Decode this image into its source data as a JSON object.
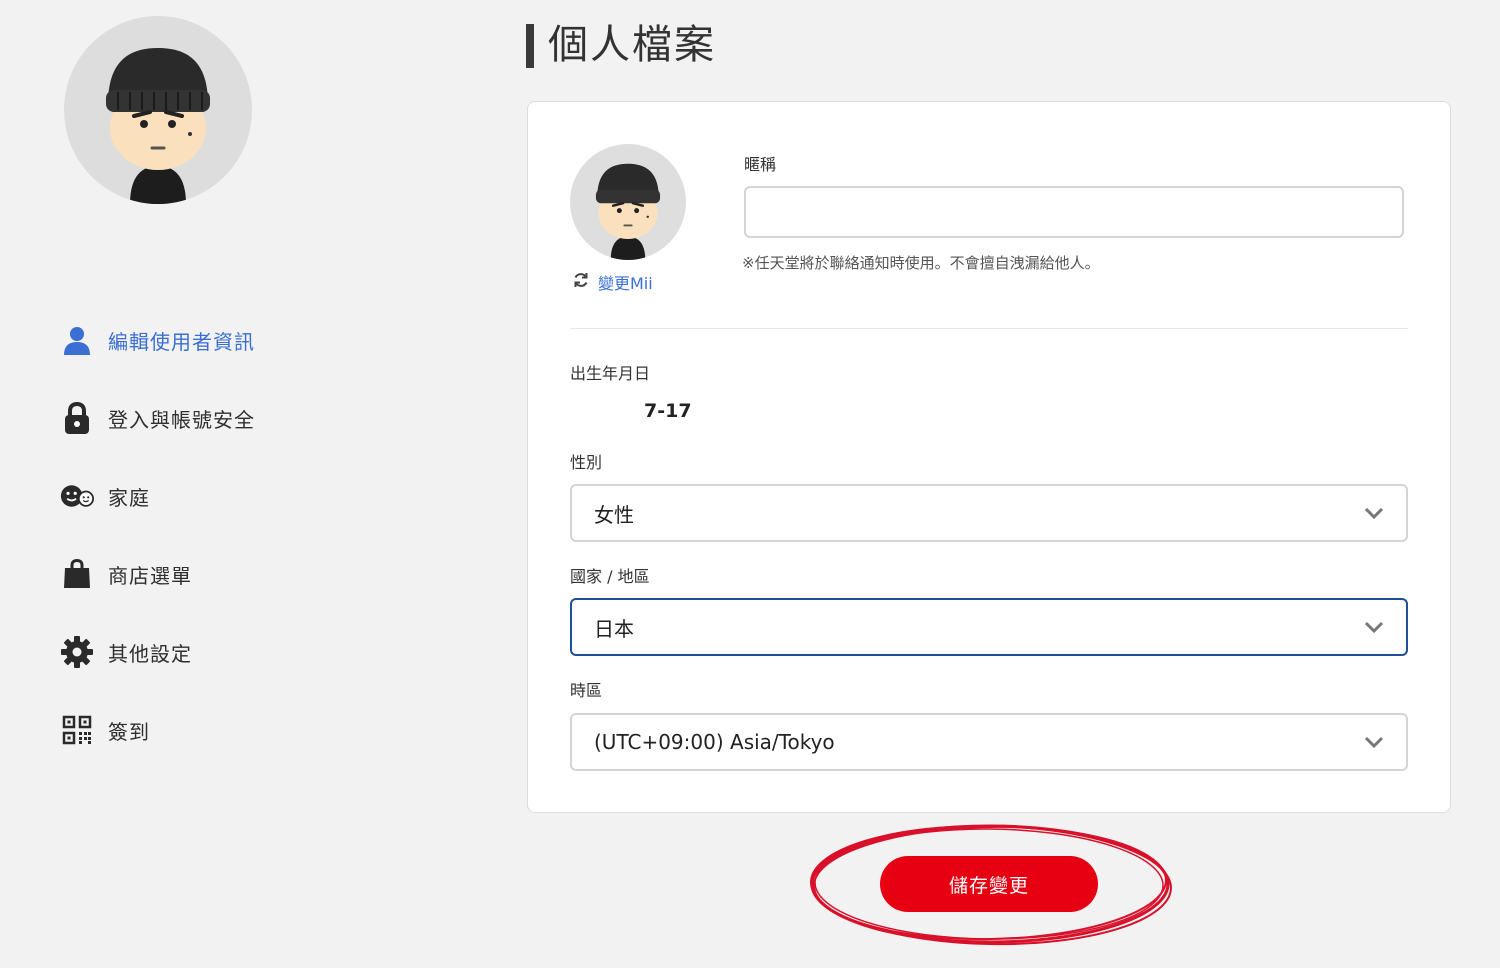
{
  "page": {
    "title": "個人檔案"
  },
  "sidebar": {
    "items": [
      {
        "label": "編輯使用者資訊",
        "icon": "user-icon",
        "active": true
      },
      {
        "label": "登入與帳號安全",
        "icon": "lock-icon",
        "active": false
      },
      {
        "label": "家庭",
        "icon": "family-icon",
        "active": false
      },
      {
        "label": "商店選單",
        "icon": "shopping-bag-icon",
        "active": false
      },
      {
        "label": "其他設定",
        "icon": "gear-icon",
        "active": false
      },
      {
        "label": "簽到",
        "icon": "qr-code-icon",
        "active": false
      }
    ]
  },
  "profile": {
    "change_mii_label": "變更Mii",
    "nickname": {
      "label": "暱稱",
      "value": "",
      "placeholder": "",
      "note": "※任天堂將於聯絡通知時使用。不會擅自洩漏給他人。"
    },
    "birthday": {
      "label": "出生年月日",
      "value": "7-17"
    },
    "gender": {
      "label": "性別",
      "value": "女性"
    },
    "country": {
      "label": "國家 / 地區",
      "value": "日本"
    },
    "timezone": {
      "label": "時區",
      "value": "(UTC+09:00) Asia/Tokyo"
    }
  },
  "actions": {
    "save_label": "儲存變更"
  },
  "colors": {
    "accent_blue": "#3b6fd4",
    "save_red": "#e60012",
    "focus_border": "#1f4f9c",
    "annotation_red": "#d8102a"
  }
}
